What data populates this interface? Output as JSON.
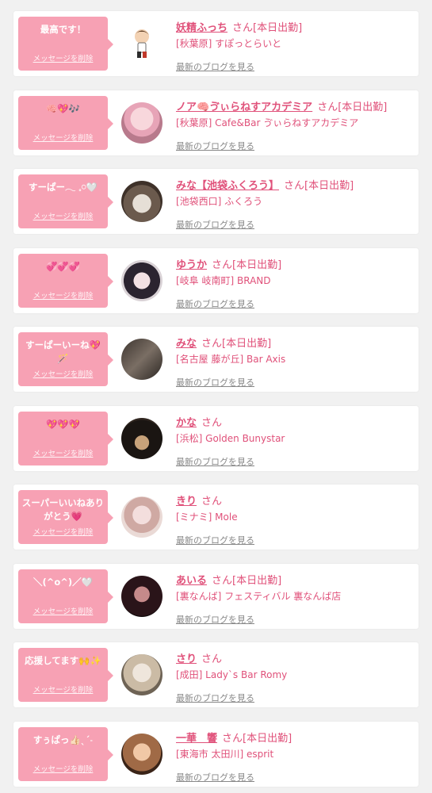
{
  "notifications": [
    {
      "message": "最高です！",
      "delete_label": "メッセージを削除",
      "name": "妖精ふっち",
      "honorific": "さん",
      "status": "[本日出勤]",
      "shop": "[秋葉原] すぽっとらいと",
      "blog_link": "最新のブログを見る",
      "avatar_icon": "chibi-character-icon"
    },
    {
      "message": "🧠💖🎶",
      "delete_label": "メッセージを削除",
      "name": "ノア🧠ゔぃらねすアカデミア",
      "honorific": "さん",
      "status": "[本日出勤]",
      "shop": "[秋葉原] Cafe&Bar ゔぃらねすアカデミア",
      "blog_link": "最新のブログを見る",
      "avatar_icon": "profile-photo"
    },
    {
      "message": "すーぱー𓂃 𓈒𓏸🤍",
      "delete_label": "メッセージを削除",
      "name": "みな【池袋ふくろう】",
      "honorific": "さん",
      "status": "[本日出勤]",
      "shop": "[池袋西口] ふくろう",
      "blog_link": "最新のブログを見る",
      "avatar_icon": "profile-photo"
    },
    {
      "message": "💞💞💞",
      "delete_label": "メッセージを削除",
      "name": "ゆうか",
      "honorific": "さん",
      "status": "[本日出勤]",
      "shop": "[岐阜 岐南町] BRAND",
      "blog_link": "最新のブログを見る",
      "avatar_icon": "profile-photo"
    },
    {
      "message": "すーぱーいーね💖🪄",
      "delete_label": "メッセージを削除",
      "name": "みな",
      "honorific": "さん",
      "status": "[本日出勤]",
      "shop": "[名古屋 藤が丘] Bar Axis",
      "blog_link": "最新のブログを見る",
      "avatar_icon": "profile-photo"
    },
    {
      "message": "💖💖💖",
      "delete_label": "メッセージを削除",
      "name": "かな",
      "honorific": "さん",
      "status": "",
      "shop": "[浜松] Golden Bunystar",
      "blog_link": "最新のブログを見る",
      "avatar_icon": "profile-photo"
    },
    {
      "message": "スーパーいいねありがとう💗",
      "delete_label": "メッセージを削除",
      "name": "きり",
      "honorific": "さん",
      "status": "",
      "shop": "[ミナミ] Mole",
      "blog_link": "最新のブログを見る",
      "avatar_icon": "profile-photo"
    },
    {
      "message": "＼(^o^)／🤍",
      "delete_label": "メッセージを削除",
      "name": "あいる",
      "honorific": "さん",
      "status": "[本日出勤]",
      "shop": "[裏なんば] フェスティバル 裏なんば店",
      "blog_link": "最新のブログを見る",
      "avatar_icon": "profile-photo"
    },
    {
      "message": "応援してます🙌✨",
      "delete_label": "メッセージを削除",
      "name": "さり",
      "honorific": "さん",
      "status": "",
      "shop": "[成田] Lady`s Bar Romy",
      "blog_link": "最新のブログを見る",
      "avatar_icon": "profile-photo"
    },
    {
      "message": "すぅぱっ👍🏻ˎˊ˗",
      "delete_label": "メッセージを削除",
      "name": "一華　響",
      "honorific": "さん",
      "status": "[本日出勤]",
      "shop": "[東海市 太田川] esprit",
      "blog_link": "最新のブログを見る",
      "avatar_icon": "profile-photo"
    }
  ]
}
